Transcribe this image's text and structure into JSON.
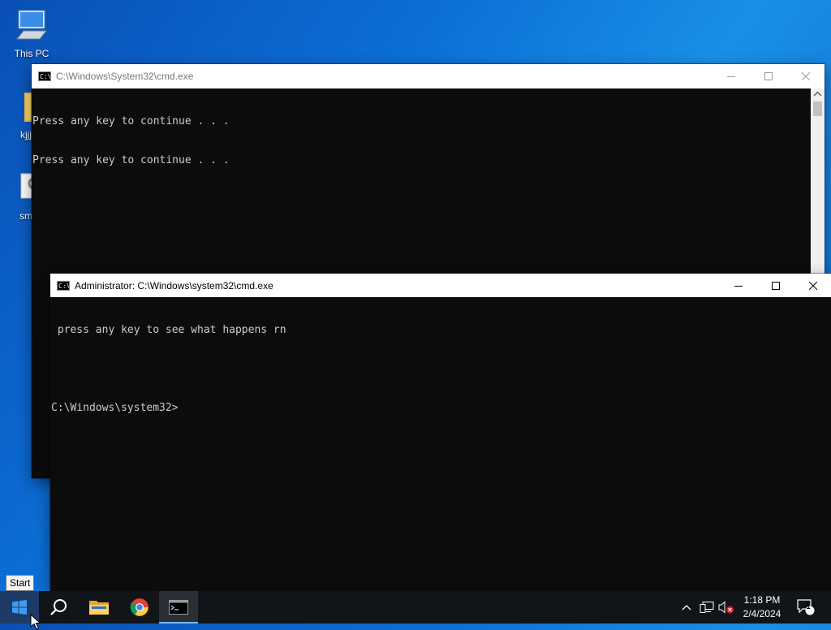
{
  "desktop": {
    "icons": [
      {
        "label": "This PC",
        "icon": "computer-icon"
      },
      {
        "label": "kjjj",
        "icon": "folder-icon"
      },
      {
        "label": "sm",
        "icon": "settings-file-icon"
      }
    ]
  },
  "window_back": {
    "title": "C:\\Windows\\System32\\cmd.exe",
    "lines": [
      "Press any key to continue . . .",
      "Press any key to continue . . ."
    ]
  },
  "window_front": {
    "title": "Administrator: C:\\Windows\\system32\\cmd.exe",
    "lines": [
      " press any key to see what happens rn",
      "",
      "C:\\Windows\\system32>"
    ]
  },
  "tooltip": {
    "text": "Start"
  },
  "taskbar": {
    "items": [
      "start-button",
      "search-button",
      "file-explorer",
      "chrome",
      "cmd"
    ],
    "time": "1:18 PM",
    "date": "2/4/2024",
    "notification_count": "1"
  },
  "colors": {
    "console_bg": "#0c0c0c",
    "console_text": "#cccccc",
    "taskbar": "#111418",
    "active_underline": "#7ab7ff"
  }
}
